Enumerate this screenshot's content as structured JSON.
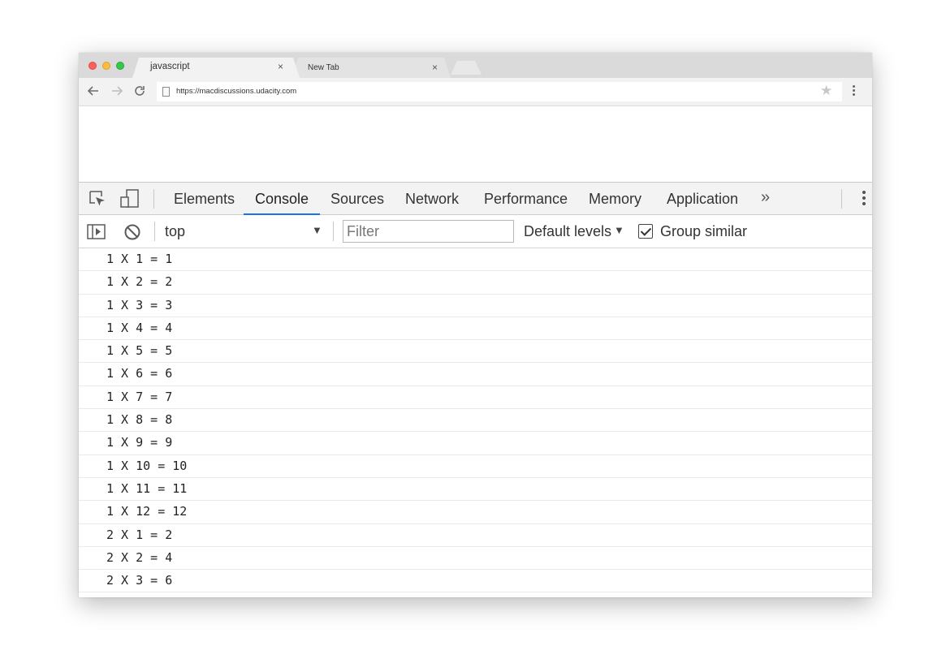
{
  "browser": {
    "tabs": [
      {
        "title": "javascript",
        "active": true
      },
      {
        "title": "New Tab",
        "active": false
      }
    ],
    "tab_close_glyph": "×",
    "url": "https://macdiscussions.udacity.com"
  },
  "devtools": {
    "tabs": [
      "Elements",
      "Console",
      "Sources",
      "Network",
      "Performance",
      "Memory",
      "Application"
    ],
    "selected_tab": "Console",
    "more_tabs_glyph": "»",
    "console_toolbar": {
      "context": "top",
      "filter_placeholder": "Filter",
      "filter_value": "",
      "levels": "Default levels",
      "group_similar_label": "Group similar",
      "group_similar_checked": true
    },
    "console_output": [
      "1 X 1 = 1",
      "1 X 2 = 2",
      "1 X 3 = 3",
      "1 X 4 = 4",
      "1 X 5 = 5",
      "1 X 6 = 6",
      "1 X 7 = 7",
      "1 X 8 = 8",
      "1 X 9 = 9",
      "1 X 10 = 10",
      "1 X 11 = 11",
      "1 X 12 = 12",
      "2 X 1 = 2",
      "2 X 2 = 4",
      "2 X 3 = 6"
    ]
  },
  "icons": {
    "back": "arrow-left-icon",
    "forward": "arrow-right-icon",
    "reload": "reload-icon",
    "bookmark": "star-icon",
    "inspect": "inspect-element-icon",
    "device": "device-toolbar-icon",
    "sidebar": "console-sidebar-icon",
    "clear": "clear-console-icon"
  },
  "colors": {
    "traffic_red": "#fc605c",
    "traffic_yellow": "#fdbc40",
    "traffic_green": "#34c84a",
    "selected_tab_underline": "#1a73e8"
  }
}
